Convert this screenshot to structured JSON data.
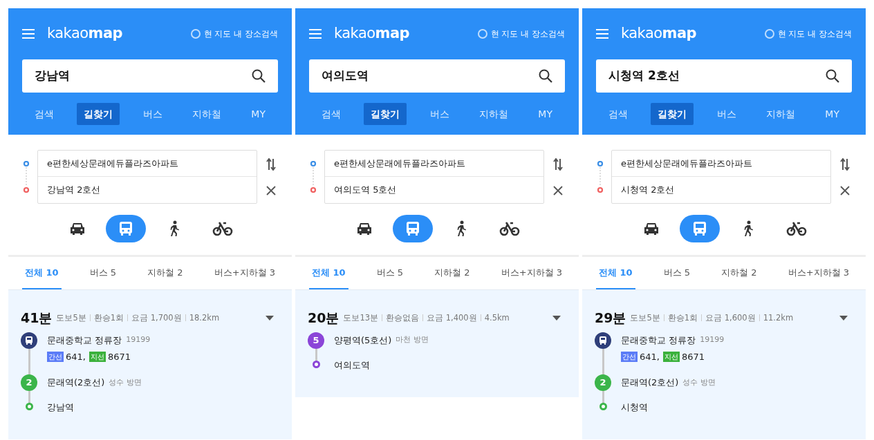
{
  "panels": [
    {
      "logo": "kakao**map**",
      "scope_checked": false,
      "scope_label": "현 지도 내 장소검색",
      "search_value": "강남역",
      "nav_tabs": [
        {
          "label": "검색",
          "selected": false
        },
        {
          "label": "길찾기",
          "selected": true
        },
        {
          "label": "버스",
          "selected": false
        },
        {
          "label": "지하철",
          "selected": false
        },
        {
          "label": "MY",
          "selected": false
        }
      ],
      "route": {
        "origin": "e편한세상문래에듀플라즈아파트",
        "destination": "강남역 2호선"
      },
      "modes": [
        {
          "kind": "car",
          "selected": false
        },
        {
          "kind": "transit",
          "selected": true
        },
        {
          "kind": "walk",
          "selected": false
        },
        {
          "kind": "bike",
          "selected": false
        }
      ],
      "result_tabs": [
        {
          "label": "전체 10",
          "selected": true
        },
        {
          "label": "버스 5",
          "selected": false
        },
        {
          "label": "지하철 2",
          "selected": false
        },
        {
          "label": "버스+지하철 3",
          "selected": false
        }
      ],
      "result": {
        "duration": "41분",
        "summary": [
          "도보5분",
          "환승1회",
          "요금 1,700원",
          "18.2km"
        ],
        "steps": [
          {
            "kind": "bus",
            "name": "문래중학교 정류장",
            "stop_id": "19199",
            "buses": [
              {
                "type": "간선",
                "color": "#5b7cf7",
                "number": "641,"
              },
              {
                "type": "지선",
                "color": "#3bb13b",
                "number": "8671"
              }
            ]
          },
          {
            "kind": "subway",
            "line": "2",
            "color": "#3bb54a",
            "name": "문래역(2호선)",
            "direction": "성수 방면"
          },
          {
            "kind": "end",
            "color": "#3bb54a",
            "name": "강남역"
          }
        ]
      }
    },
    {
      "logo": "kakao**map**",
      "scope_checked": false,
      "scope_label": "현 지도 내 장소검색",
      "search_value": "여의도역",
      "nav_tabs": [
        {
          "label": "검색",
          "selected": false
        },
        {
          "label": "길찾기",
          "selected": true
        },
        {
          "label": "버스",
          "selected": false
        },
        {
          "label": "지하철",
          "selected": false
        },
        {
          "label": "MY",
          "selected": false
        }
      ],
      "route": {
        "origin": "e편한세상문래에듀플라즈아파트",
        "destination": "여의도역 5호선"
      },
      "modes": [
        {
          "kind": "car",
          "selected": false
        },
        {
          "kind": "transit",
          "selected": true
        },
        {
          "kind": "walk",
          "selected": false
        },
        {
          "kind": "bike",
          "selected": false
        }
      ],
      "result_tabs": [
        {
          "label": "전체 10",
          "selected": true
        },
        {
          "label": "버스 5",
          "selected": false
        },
        {
          "label": "지하철 2",
          "selected": false
        },
        {
          "label": "버스+지하철 3",
          "selected": false
        }
      ],
      "result": {
        "duration": "20분",
        "summary": [
          "도보13분",
          "환승없음",
          "요금 1,400원",
          "4.5km"
        ],
        "steps": [
          {
            "kind": "subway",
            "line": "5",
            "color": "#8b45d8",
            "name": "양평역(5호선)",
            "direction": "마천 방면"
          },
          {
            "kind": "end",
            "color": "#8b45d8",
            "name": "여의도역"
          }
        ]
      }
    },
    {
      "logo": "kakao**map**",
      "scope_checked": false,
      "scope_label": "현 지도 내 장소검색",
      "search_value": "시청역 2호선",
      "nav_tabs": [
        {
          "label": "검색",
          "selected": false
        },
        {
          "label": "길찾기",
          "selected": true
        },
        {
          "label": "버스",
          "selected": false
        },
        {
          "label": "지하철",
          "selected": false
        },
        {
          "label": "MY",
          "selected": false
        }
      ],
      "route": {
        "origin": "e편한세상문래에듀플라즈아파트",
        "destination": "시청역 2호선"
      },
      "modes": [
        {
          "kind": "car",
          "selected": false
        },
        {
          "kind": "transit",
          "selected": true
        },
        {
          "kind": "walk",
          "selected": false
        },
        {
          "kind": "bike",
          "selected": false
        }
      ],
      "result_tabs": [
        {
          "label": "전체 10",
          "selected": true
        },
        {
          "label": "버스 5",
          "selected": false
        },
        {
          "label": "지하철 2",
          "selected": false
        },
        {
          "label": "버스+지하철 3",
          "selected": false
        }
      ],
      "result": {
        "duration": "29분",
        "summary": [
          "도보5분",
          "환승1회",
          "요금 1,600원",
          "11.2km"
        ],
        "steps": [
          {
            "kind": "bus",
            "name": "문래중학교 정류장",
            "stop_id": "19199",
            "buses": [
              {
                "type": "간선",
                "color": "#5b7cf7",
                "number": "641,"
              },
              {
                "type": "지선",
                "color": "#3bb13b",
                "number": "8671"
              }
            ]
          },
          {
            "kind": "subway",
            "line": "2",
            "color": "#3bb54a",
            "name": "문래역(2호선)",
            "direction": "성수 방면"
          },
          {
            "kind": "end",
            "color": "#3bb54a",
            "name": "시청역"
          }
        ]
      }
    }
  ]
}
